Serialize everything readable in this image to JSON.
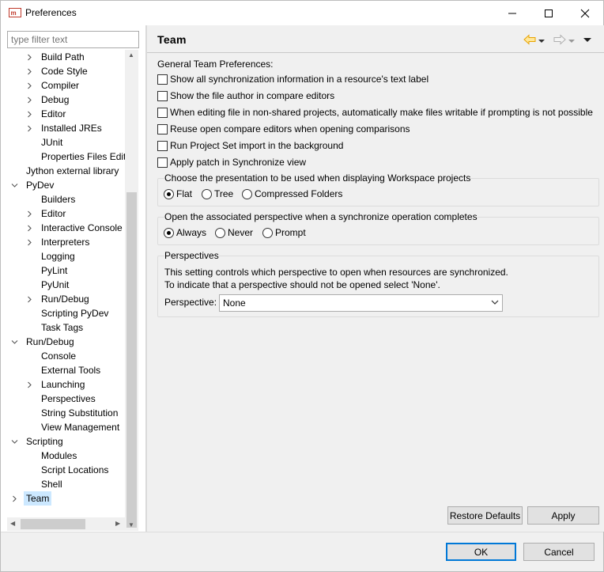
{
  "window": {
    "title": "Preferences",
    "minimize_glyph": "—",
    "maximize_glyph": "☐",
    "close_glyph": "✕"
  },
  "filter": {
    "placeholder": "type filter text"
  },
  "tree": {
    "items": [
      {
        "label": "Build Path",
        "expandable": true,
        "level": 2
      },
      {
        "label": "Code Style",
        "expandable": true,
        "level": 2
      },
      {
        "label": "Compiler",
        "expandable": true,
        "level": 2
      },
      {
        "label": "Debug",
        "expandable": true,
        "level": 2
      },
      {
        "label": "Editor",
        "expandable": true,
        "level": 2
      },
      {
        "label": "Installed JREs",
        "expandable": true,
        "level": 2
      },
      {
        "label": "JUnit",
        "expandable": false,
        "level": 2
      },
      {
        "label": "Properties Files Edito",
        "expandable": false,
        "level": 2
      },
      {
        "label": "Jython external library",
        "expandable": false,
        "level": 1
      },
      {
        "label": "PyDev",
        "expandable": true,
        "expanded": true,
        "level": 1
      },
      {
        "label": "Builders",
        "expandable": false,
        "level": 2
      },
      {
        "label": "Editor",
        "expandable": true,
        "level": 2
      },
      {
        "label": "Interactive Console",
        "expandable": true,
        "level": 2
      },
      {
        "label": "Interpreters",
        "expandable": true,
        "level": 2
      },
      {
        "label": "Logging",
        "expandable": false,
        "level": 2
      },
      {
        "label": "PyLint",
        "expandable": false,
        "level": 2
      },
      {
        "label": "PyUnit",
        "expandable": false,
        "level": 2
      },
      {
        "label": "Run/Debug",
        "expandable": true,
        "level": 2
      },
      {
        "label": "Scripting PyDev",
        "expandable": false,
        "level": 2
      },
      {
        "label": "Task Tags",
        "expandable": false,
        "level": 2
      },
      {
        "label": "Run/Debug",
        "expandable": true,
        "expanded": true,
        "level": 1
      },
      {
        "label": "Console",
        "expandable": false,
        "level": 2
      },
      {
        "label": "External Tools",
        "expandable": false,
        "level": 2
      },
      {
        "label": "Launching",
        "expandable": true,
        "level": 2
      },
      {
        "label": "Perspectives",
        "expandable": false,
        "level": 2
      },
      {
        "label": "String Substitution",
        "expandable": false,
        "level": 2
      },
      {
        "label": "View Management",
        "expandable": false,
        "level": 2
      },
      {
        "label": "Scripting",
        "expandable": true,
        "expanded": true,
        "level": 1
      },
      {
        "label": "Modules",
        "expandable": false,
        "level": 2
      },
      {
        "label": "Script Locations",
        "expandable": false,
        "level": 2
      },
      {
        "label": "Shell",
        "expandable": false,
        "level": 2
      },
      {
        "label": "Team",
        "expandable": true,
        "level": 1,
        "selected": true
      }
    ]
  },
  "page": {
    "title": "Team",
    "general_label": "General Team Preferences:",
    "checkboxes": [
      {
        "label": "Show all synchronization information in a resource's text label",
        "checked": false
      },
      {
        "label": "Show the file author in compare editors",
        "checked": false
      },
      {
        "label": "When editing file in non-shared projects, automatically make files writable if prompting is not possible",
        "checked": false
      },
      {
        "label": "Reuse open compare editors when opening comparisons",
        "checked": false
      },
      {
        "label": "Run Project Set import in the background",
        "checked": false
      },
      {
        "label": "Apply patch in Synchronize view",
        "checked": false
      }
    ],
    "presentation": {
      "title": "Choose the presentation to be used when displaying Workspace projects",
      "options": [
        {
          "label": "Flat",
          "checked": true
        },
        {
          "label": "Tree",
          "checked": false
        },
        {
          "label": "Compressed Folders",
          "checked": false
        }
      ]
    },
    "open_perspective": {
      "title": "Open the associated perspective when a synchronize operation completes",
      "options": [
        {
          "label": "Always",
          "checked": true
        },
        {
          "label": "Never",
          "checked": false
        },
        {
          "label": "Prompt",
          "checked": false
        }
      ]
    },
    "perspectives": {
      "title": "Perspectives",
      "description_line1": "This setting controls which perspective to open when resources are synchronized.",
      "description_line2": "To indicate that a perspective should not be opened select 'None'.",
      "field_label": "Perspective:",
      "selected_value": "None"
    },
    "restore_defaults_label": "Restore Defaults",
    "apply_label": "Apply"
  },
  "footer": {
    "ok_label": "OK",
    "cancel_label": "Cancel"
  },
  "colors": {
    "selection": "#cce8ff",
    "default_button_border": "#0078d7",
    "back_arrow": "#e8a300"
  }
}
